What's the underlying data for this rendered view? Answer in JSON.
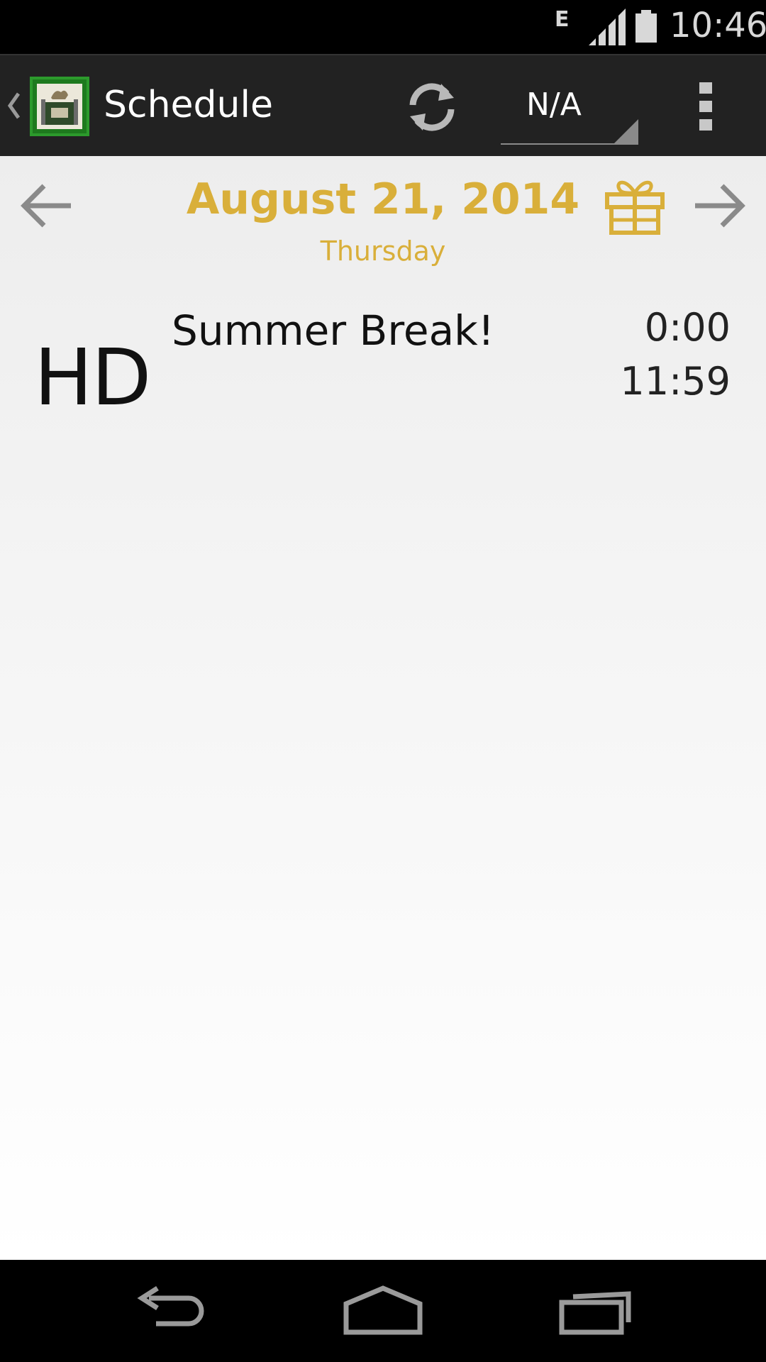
{
  "status_bar": {
    "network_type": "E",
    "time": "10:46",
    "icons": [
      "signal-icon",
      "battery-icon"
    ]
  },
  "action_bar": {
    "icons": [
      "up-caret-icon",
      "app-logo",
      "refresh-icon",
      "overflow-menu-icon"
    ],
    "title": "Schedule",
    "selector_value": "N/A"
  },
  "date_nav": {
    "date": "August 21, 2014",
    "weekday": "Thursday",
    "icons": [
      "arrow-left-icon",
      "gift-icon",
      "arrow-right-icon"
    ],
    "accent_color": "#d9af3a"
  },
  "schedule": {
    "items": [
      {
        "code": "HD",
        "name": "Summer Break!",
        "start": "0:00",
        "end": "11:59"
      }
    ]
  },
  "nav_bar": {
    "icons": [
      "back-icon",
      "home-icon",
      "recents-icon"
    ]
  }
}
